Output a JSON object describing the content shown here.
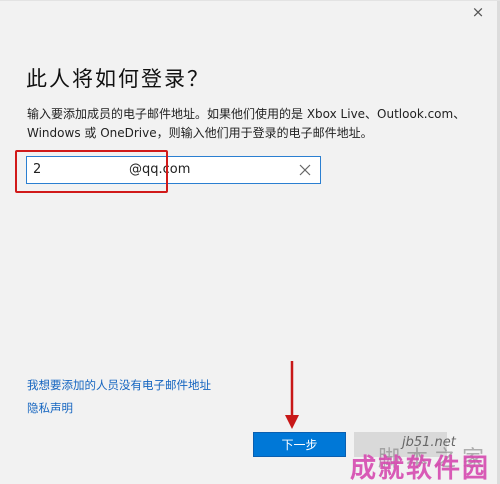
{
  "window": {
    "close_glyph": "×"
  },
  "title": "此人将如何登录？",
  "description": "输入要添加成员的电子邮件地址。如果他们使用的是 Xbox Live、Outlook.com、Windows 或 OneDrive，则输入他们用于登录的电子邮件地址。",
  "email": {
    "prefix": "2",
    "suffix": "@qq.com",
    "clear_icon": "close-icon"
  },
  "links": {
    "no_email": "我想要添加的人员没有电子邮件地址",
    "privacy": "隐私声明"
  },
  "buttons": {
    "next": "下一步"
  },
  "watermark": {
    "url": "jb51.net",
    "text": "成就软件园",
    "sub": "脚本之家"
  },
  "colors": {
    "accent": "#0078d7",
    "highlight": "#d11a1a",
    "link": "#1565c0",
    "background": "#f2f2f2"
  }
}
